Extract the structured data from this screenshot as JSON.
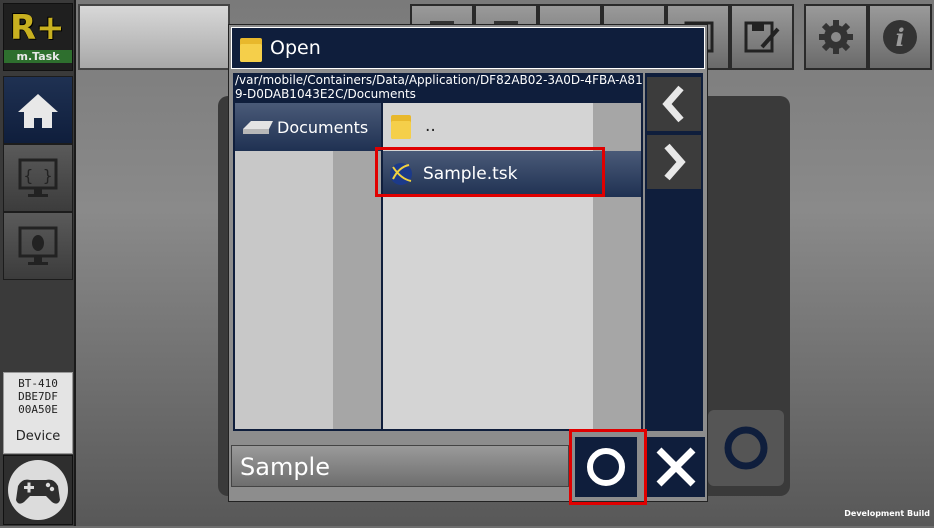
{
  "app": {
    "logo_text": "R+",
    "logo_subtitle": "m.Task",
    "footer_build": "Development Build"
  },
  "sidebar": {
    "items": [
      {
        "name": "home",
        "icon": "home-icon"
      },
      {
        "name": "code",
        "icon": "code-monitor-icon"
      },
      {
        "name": "debug",
        "icon": "bug-monitor-icon"
      }
    ],
    "device": {
      "line1": "BT-410",
      "line2": "DBE7DF",
      "line3": "00A50E",
      "label": "Device"
    }
  },
  "toolbar": {
    "buttons": [
      "new-file-icon",
      "open-file-icon",
      "folder-icon",
      "save-icon",
      "save-as-icon",
      "settings-icon",
      "info-icon"
    ]
  },
  "dialog": {
    "title": "Open",
    "path": "/var/mobile/Containers/Data/Application/DF82AB02-3A0D-4FBA-A819-D0DAB1043E2C/Documents",
    "directories": [
      {
        "label": "Documents",
        "selected": true
      }
    ],
    "files": [
      {
        "label": "..",
        "type": "parent-folder"
      },
      {
        "label": "Sample.tsk",
        "type": "task-file",
        "selected": true
      }
    ],
    "filename": "Sample",
    "ok_label": "O",
    "cancel_label": "X"
  },
  "colors": {
    "dialog_navy": "#0f1e3c",
    "highlight_red": "#e00000",
    "logo_gold": "#c8b020"
  }
}
